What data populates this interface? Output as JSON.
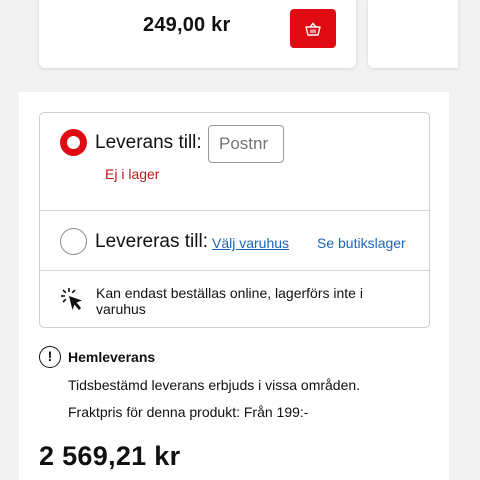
{
  "product_card": {
    "price": "249,00 kr",
    "cart_icon": "basket-icon"
  },
  "delivery": {
    "option1": {
      "label": "Leverans till:",
      "postnr_placeholder": "Postnr",
      "stock_status": "Ej i lager"
    },
    "option2": {
      "label": "Levereras till:",
      "choose_store": "Välj varuhus",
      "see_stock": "Se butikslager"
    },
    "online_note": "Kan endast beställas online, lagerförs inte i varuhus"
  },
  "home_delivery": {
    "title": "Hemleverans",
    "line1": "Tidsbestämd leverans erbjuds i vissa områden.",
    "line2": "Fraktpris för denna produkt: Från 199:-"
  },
  "total_price": "2 569,21 kr",
  "colors": {
    "accent": "#e00a12",
    "link": "#1a64b8",
    "stock": "#c2151b"
  }
}
